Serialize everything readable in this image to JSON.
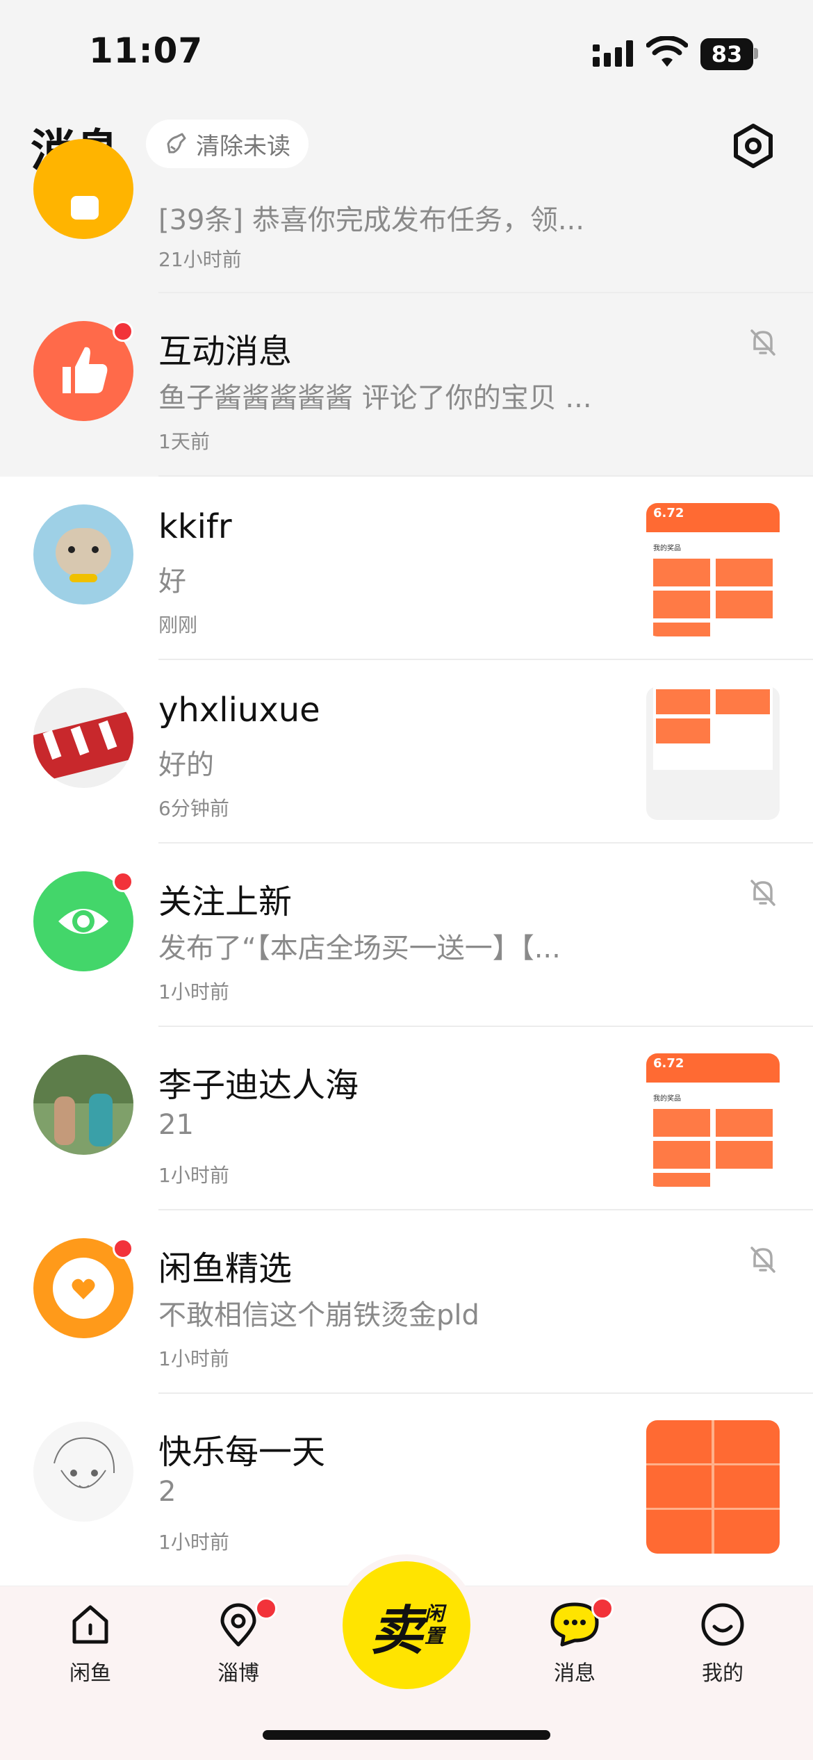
{
  "status": {
    "time": "11:07",
    "battery": "83"
  },
  "header": {
    "title": "消息",
    "clear_unread": "清除未读"
  },
  "messages": [
    {
      "name": "",
      "preview": "[39条] 恭喜你完成发布任务，领...",
      "time": "21小时前"
    },
    {
      "name": "互动消息",
      "preview": "鱼子酱酱酱酱酱 评论了你的宝贝 ...",
      "time": "1天前"
    },
    {
      "name": "kkifr",
      "preview": "好",
      "time": "刚刚"
    },
    {
      "name": "yhxliuxue",
      "preview": "好的",
      "time": "6分钟前"
    },
    {
      "name": "关注上新",
      "preview": "发布了“【本店全场买一送一】【...",
      "time": "1小时前"
    },
    {
      "name": "李子迪达人海",
      "preview": "21",
      "time": "1小时前"
    },
    {
      "name": "闲鱼精选",
      "preview": "不敢相信这个崩铁烫金pld",
      "time": "1小时前"
    },
    {
      "name": "快乐每一天",
      "preview": "2",
      "time": "1小时前"
    }
  ],
  "thumb_text": {
    "price": "6.72",
    "section": "我的奖品"
  },
  "tabbar": {
    "home": "闲鱼",
    "zibo": "淄博",
    "sell_big": "卖",
    "sell_small": "闲置",
    "messages": "消息",
    "mine": "我的"
  },
  "colors": {
    "accent": "#ffe400",
    "badge": "#f2333a",
    "orange": "#ff6a33"
  }
}
